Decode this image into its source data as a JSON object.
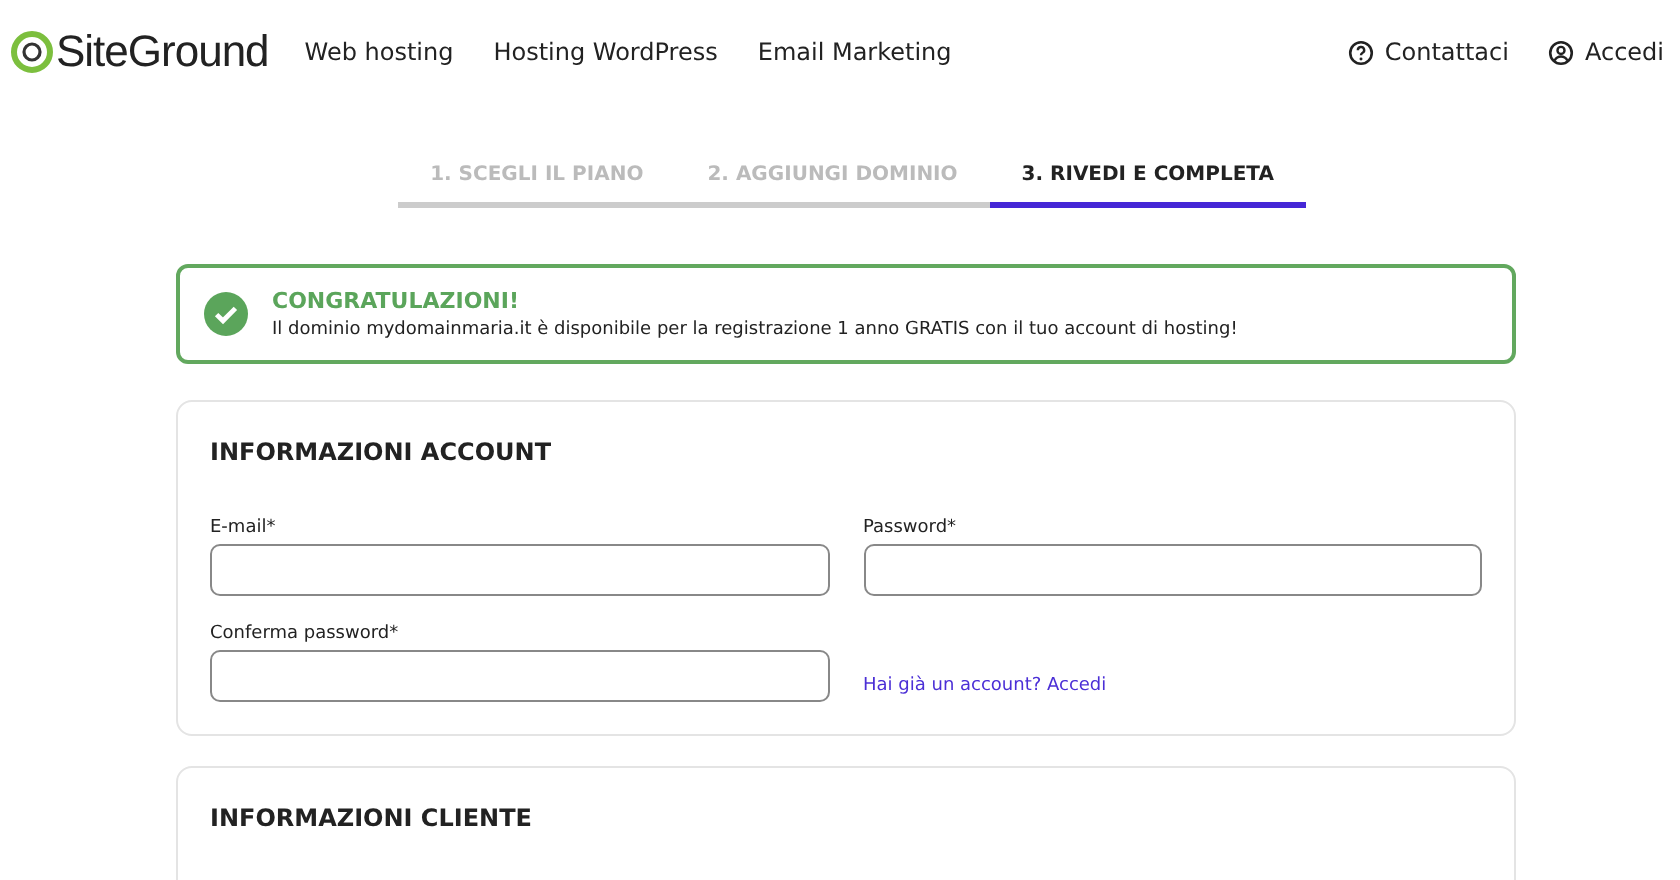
{
  "header": {
    "logo": "SiteGround",
    "nav": [
      "Web hosting",
      "Hosting WordPress",
      "Email Marketing"
    ],
    "actions": [
      {
        "kind": "help",
        "label": "Contattaci"
      },
      {
        "kind": "user",
        "label": "Accedi"
      }
    ]
  },
  "steps": [
    {
      "label": "1. SCEGLI IL PIANO",
      "selected": false
    },
    {
      "label": "2. AGGIUNGI DOMINIO",
      "selected": false
    },
    {
      "label": "3. RIVEDI E COMPLETA",
      "selected": true
    }
  ],
  "alert": {
    "title": "CONGRATULAZIONI!",
    "message": "Il dominio mydomainmaria.it è disponibile per la registrazione 1 anno GRATIS con il tuo account di hosting!"
  },
  "account": {
    "title": "INFORMAZIONI ACCOUNT",
    "fields": [
      {
        "label": "E-mail*"
      },
      {
        "label": "Password*"
      },
      {
        "label": "Conferma password*"
      }
    ],
    "link": "Hai già un account? Accedi"
  },
  "customer": {
    "title": "INFORMAZIONI CLIENTE"
  }
}
